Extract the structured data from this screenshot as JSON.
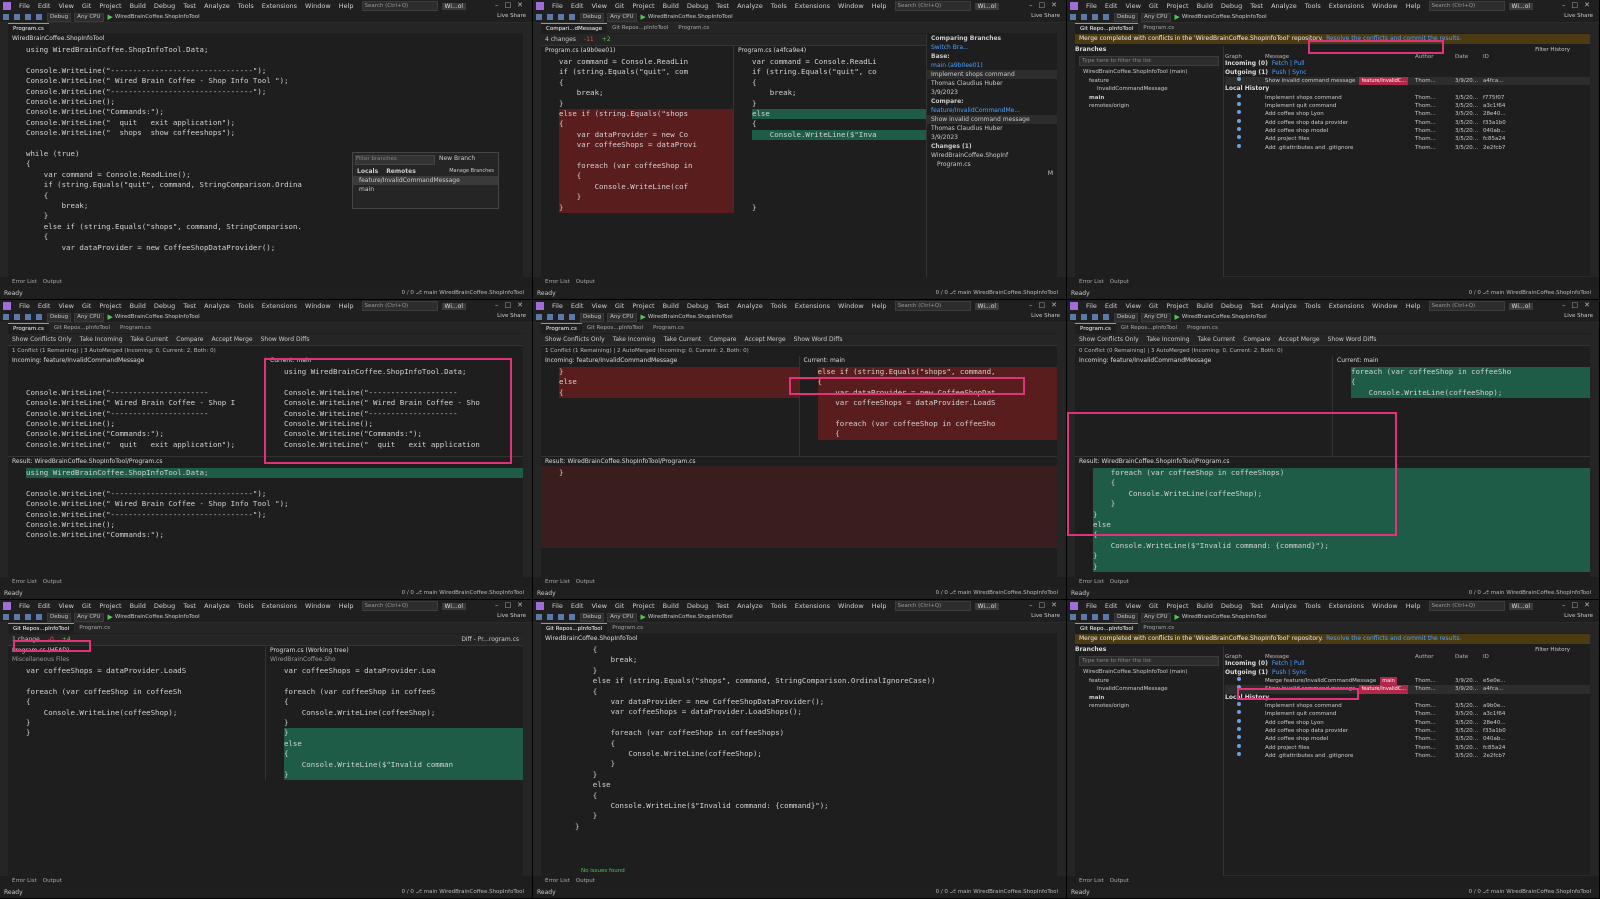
{
  "menu": [
    "File",
    "Edit",
    "View",
    "Git",
    "Project",
    "Build",
    "Debug",
    "Test",
    "Analyze",
    "Tools",
    "Extensions",
    "Window",
    "Help"
  ],
  "search_placeholder": "Search (Ctrl+Q)",
  "solution_badge": "Wi...ol",
  "toolbar": {
    "config": "Debug",
    "platform": "Any CPU",
    "start_target": "WiredBrainCoffee.ShopInfoTool"
  },
  "live_share": "Live Share",
  "status": {
    "ready": "Ready",
    "branch": "main",
    "project": "WiredBrainCoffee.ShopInfoTool",
    "counts": "0 / 0"
  },
  "bottom_tabs": {
    "errors": "Error List",
    "output": "Output"
  },
  "panel1": {
    "tab": "Program.cs",
    "nav": "WiredBrainCoffee.ShopInfoTool",
    "code": [
      "using WiredBrainCoffee.ShopInfoTool.Data;",
      "",
      "Console.WriteLine(\"--------------------------------\");",
      "Console.WriteLine(\" Wired Brain Coffee - Shop Info Tool \");",
      "Console.WriteLine(\"--------------------------------\");",
      "Console.WriteLine();",
      "Console.WriteLine(\"Commands:\");",
      "Console.WriteLine(\"  quit   exit application\");",
      "Console.WriteLine(\"  shops  show coffeeshops\");",
      "",
      "while (true)",
      "{",
      "    var command = Console.ReadLine();",
      "    if (string.Equals(\"quit\", command, StringComparison.Ordina",
      "    {",
      "        break;",
      "    }",
      "    else if (string.Equals(\"shops\", command, StringComparison.",
      "    {",
      "        var dataProvider = new CoffeeShopDataProvider();"
    ],
    "popup": {
      "filter_placeholder": "Filter branches",
      "new_branch": "New Branch",
      "locals": "Locals",
      "remotes": "Remotes",
      "manage": "Manage Branches",
      "branches": [
        "feature/InvalidCommandMessage",
        "main"
      ]
    }
  },
  "panel2": {
    "tabs": [
      "Compari...dMessage",
      "Git Repos...pInfoTool",
      "Program.cs"
    ],
    "changes": "4 changes",
    "del_count": "-11",
    "add_count": "+2",
    "left_title": "Program.cs (a9b0ee01)",
    "right_title": "Program.cs (a4fca9e4)",
    "left_code": [
      "var command = Console.ReadLin",
      "if (string.Equals(\"quit\", com",
      "{",
      "    break;",
      "}",
      "else if (string.Equals(\"shops",
      "{",
      "    var dataProvider = new Co",
      "    var coffeeShops = dataProvi",
      "",
      "    foreach (var coffeeShop in",
      "    {",
      "        Console.WriteLine(cof",
      "    }",
      "}"
    ],
    "right_code": [
      "var command = Console.ReadLi",
      "if (string.Equals(\"quit\", co",
      "{",
      "    break;",
      "}",
      "else",
      "{",
      "    Console.WriteLine($\"Inva",
      "",
      "",
      "",
      "",
      "",
      "",
      "}"
    ],
    "compare": {
      "title": "Comparing Branches",
      "switch": "Switch Bra...",
      "base_label": "Base:",
      "base": "main (a9b0ee01)",
      "commit1": "Implement shops command",
      "author1": "Thomas Claudius Huber",
      "date1": "3/9/2023",
      "compare_label": "Compare:",
      "compare": "feature/InvalidCommandMe...",
      "commit2": "Show invalid command message",
      "author2": "Thomas Claudius Huber",
      "date2": "3/9/2023",
      "changes": "Changes (1)",
      "tree_root": "WiredBrainCoffee.ShopInf",
      "tree_file": "Program.cs",
      "tree_flag": "M"
    }
  },
  "panel3": {
    "tabs": [
      "Git Repo...pInfoTool",
      "Program.cs"
    ],
    "banner": "Merge completed with conflicts in the 'WiredBrainCoffee.ShopInfoTool' repository.",
    "banner_link": "Resolve the conflicts and commit the results.",
    "branches_title": "Branches",
    "filter_placeholder": "Type here to filter the list",
    "repo": "WiredBrainCoffee.ShopInfoTool (main)",
    "tree": [
      "feature",
      "InvalidCommandMessage",
      "main",
      "remotes/origin"
    ],
    "filter_history": "Filter History",
    "cols": [
      "Graph",
      "Message",
      "Author",
      "Date",
      "ID"
    ],
    "incoming": "Incoming (0)",
    "incoming_links": "Fetch | Pull",
    "outgoing": "Outgoing (1)",
    "outgoing_links": "Push | Sync",
    "outgoing_commit": {
      "msg": "Show invalid command message",
      "badge": "feature/InvalidC...",
      "author": "Thom...",
      "date": "3/9/20...",
      "id": "a4fca..."
    },
    "local_history": "Local History",
    "history": [
      {
        "msg": "Implement shops command",
        "author": "Thom...",
        "date": "3/5/20...",
        "id": "f775f07"
      },
      {
        "msg": "Implement quit command",
        "author": "Thom...",
        "date": "3/5/20...",
        "id": "a3c1f64"
      },
      {
        "msg": "Add coffee shop Lyon",
        "author": "Thom...",
        "date": "3/5/20...",
        "id": "28e40..."
      },
      {
        "msg": "Add coffee shop data provider",
        "author": "Thom...",
        "date": "3/5/20...",
        "id": "f33a1b0"
      },
      {
        "msg": "Add coffee shop model",
        "author": "Thom...",
        "date": "3/5/20...",
        "id": "040ab..."
      },
      {
        "msg": "Add project files",
        "author": "Thom...",
        "date": "3/5/20...",
        "id": "fc85a24"
      },
      {
        "msg": "Add .gitattributes and .gitignore",
        "author": "Thom...",
        "date": "3/5/20...",
        "id": "2e2fcb7"
      }
    ]
  },
  "merge_toolbar": {
    "show_conflicts": "Show Conflicts Only",
    "take_incoming": "Take Incoming",
    "take_current": "Take Current",
    "compare": "Compare",
    "accept": "Accept Merge",
    "word_diffs": "Show Word Diffs"
  },
  "panel4": {
    "tabs": [
      "Program.cs",
      "Git Repos...pInfoTool",
      "Program.cs"
    ],
    "conflict_info": "1 Conflict (1 Remaining) | 3 AutoMerged (Incoming: 0, Current: 2, Both: 0)",
    "incoming": "Incoming: feature/InvalidCommandMessage",
    "current": "Current: main",
    "incoming_code": [
      "",
      "",
      "Console.WriteLine(\"----------------------",
      "Console.WriteLine(\" Wired Brain Coffee - Shop I",
      "Console.WriteLine(\"----------------------",
      "Console.WriteLine();",
      "Console.WriteLine(\"Commands:\");",
      "Console.WriteLine(\"  quit   exit application\");"
    ],
    "current_code": [
      "using WiredBrainCoffee.ShopInfoTool.Data;",
      "",
      "Console.WriteLine(\"--------------------",
      "Console.WriteLine(\" Wired Brain Coffee - Sho",
      "Console.WriteLine(\"--------------------",
      "Console.WriteLine();",
      "Console.WriteLine(\"Commands:\");",
      "Console.WriteLine(\"  quit   exit application"
    ],
    "result_title": "Result: WiredBrainCoffee.ShopInfoTool/Program.cs",
    "result_code": [
      "using WiredBrainCoffee.ShopInfoTool.Data;",
      "",
      "Console.WriteLine(\"--------------------------------\");",
      "Console.WriteLine(\" Wired Brain Coffee - Shop Info Tool \");",
      "Console.WriteLine(\"--------------------------------\");",
      "Console.WriteLine();",
      "Console.WriteLine(\"Commands:\");"
    ]
  },
  "panel5": {
    "tabs": [
      "Program.cs",
      "Git Repos...pInfoTool",
      "Program.cs"
    ],
    "conflict_info": "1 Conflict (1 Remaining) | 2 AutoMerged (Incoming: 0, Current: 2, Both: 0)",
    "incoming": "Incoming: feature/InvalidCommandMessage",
    "current": "Current: main",
    "incoming_code": [
      "}",
      "else",
      "{"
    ],
    "current_code": [
      "else if (string.Equals(\"shops\", command,",
      "{",
      "    var dataProvider = new CoffeeShopDat",
      "    var coffeeShops = dataProvider.LoadS",
      "",
      "    foreach (var coffeeShop in coffeeSho",
      "    {"
    ],
    "result_title": "Result: WiredBrainCoffee.ShopInfoTool/Program.cs",
    "result_code": [
      "}"
    ]
  },
  "panel6": {
    "tabs": [
      "Program.cs",
      "Git Repos...pInfoTool",
      "Program.cs"
    ],
    "conflict_info": "0 Conflict (0 Remaining) | 3 AutoMerged (Incoming: 0, Current: 2, Both: 0)",
    "incoming": "Incoming: feature/InvalidCommandMessage",
    "current": "Current: main",
    "current_code": [
      "foreach (var coffeeShop in coffeeSho",
      "{",
      "    Console.WriteLine(coffeeShop);"
    ],
    "result_title": "Result: WiredBrainCoffee.ShopInfoTool/Program.cs",
    "result_code": [
      "    foreach (var coffeeShop in coffeeShops)",
      "    {",
      "        Console.WriteLine(coffeeShop);",
      "    }",
      "}",
      "else",
      "{",
      "    Console.WriteLine($\"Invalid command: {command}\");",
      "}",
      "}"
    ]
  },
  "panel7": {
    "tabs": [
      "Git Repos...pInfoTool",
      "Program.cs"
    ],
    "right_tab": "Diff - Pr...rogram.cs",
    "changes": "1 change",
    "del_count": "-0",
    "add_count": "+4",
    "left_title": "Program.cs (HEAD)",
    "right_title": "Program.cs (Working tree)",
    "left_nav": "Miscellaneous Files",
    "right_nav": "WiredBrainCoffee.Sho",
    "left_code": [
      "var coffeeShops = dataProvider.LoadS",
      "",
      "foreach (var coffeeShop in coffeeSh",
      "{",
      "    Console.WriteLine(coffeeShop);",
      "}",
      "}"
    ],
    "right_code": [
      "var coffeeShops = dataProvider.Loa",
      "",
      "foreach (var coffeeShop in coffeeS",
      "{",
      "    Console.WriteLine(coffeeShop);",
      "}",
      "}",
      "else",
      "{",
      "    Console.WriteLine($\"Invalid comman",
      "}"
    ]
  },
  "panel8": {
    "tabs": [
      "Git Repos...pInfoTool",
      "Program.cs"
    ],
    "right_tab": "Diff - Pr...rogram.cs",
    "nav": "WiredBrainCoffee.ShopInfoTool",
    "code": [
      "    {",
      "        break;",
      "    }",
      "    else if (string.Equals(\"shops\", command, StringComparison.OrdinalIgnoreCase))",
      "    {",
      "        var dataProvider = new CoffeeShopDataProvider();",
      "        var coffeeShops = dataProvider.LoadShops();",
      "",
      "        foreach (var coffeeShop in coffeeShops)",
      "        {",
      "            Console.WriteLine(coffeeShop);",
      "        }",
      "    }",
      "    else",
      "    {",
      "        Console.WriteLine($\"Invalid command: {command}\");",
      "    }",
      "}"
    ],
    "no_issues": "No issues found"
  },
  "panel9": {
    "tabs": [
      "Git Repo...pInfoTool",
      "Program.cs"
    ],
    "right_tab": "Diff - Pr...Program.cs",
    "banner": "Merge completed with conflicts in the 'WiredBrainCoffee.ShopInfoTool' repository.",
    "banner_link": "Resolve the conflicts and commit the results.",
    "merge_commit": {
      "msg": "Merge feature/InvalidCommandMessage",
      "badge": "main",
      "author": "Thom...",
      "date": "3/9/20...",
      "id": "e5e0e..."
    },
    "outgoing_commit": {
      "msg": "Show invalid command message",
      "badge": "feature/InvalidC...",
      "author": "Thom...",
      "date": "3/9/20...",
      "id": "a4fca..."
    },
    "history": [
      {
        "msg": "Implement shops command",
        "author": "Thom...",
        "date": "3/5/20...",
        "id": "a9b0e..."
      },
      {
        "msg": "Implement quit command",
        "author": "Thom...",
        "date": "3/5/20...",
        "id": "a3c1f64"
      },
      {
        "msg": "Add coffee shop Lyon",
        "author": "Thom...",
        "date": "3/5/20...",
        "id": "28e40..."
      },
      {
        "msg": "Add coffee shop data provider",
        "author": "Thom...",
        "date": "3/5/20...",
        "id": "f33a1b0"
      },
      {
        "msg": "Add coffee shop model",
        "author": "Thom...",
        "date": "3/5/20...",
        "id": "040ab..."
      },
      {
        "msg": "Add project files",
        "author": "Thom...",
        "date": "3/5/20...",
        "id": "fc85a24"
      },
      {
        "msg": "Add .gitattributes and .gitignore",
        "author": "Thom...",
        "date": "3/5/20...",
        "id": "2e2fcb7"
      }
    ]
  }
}
